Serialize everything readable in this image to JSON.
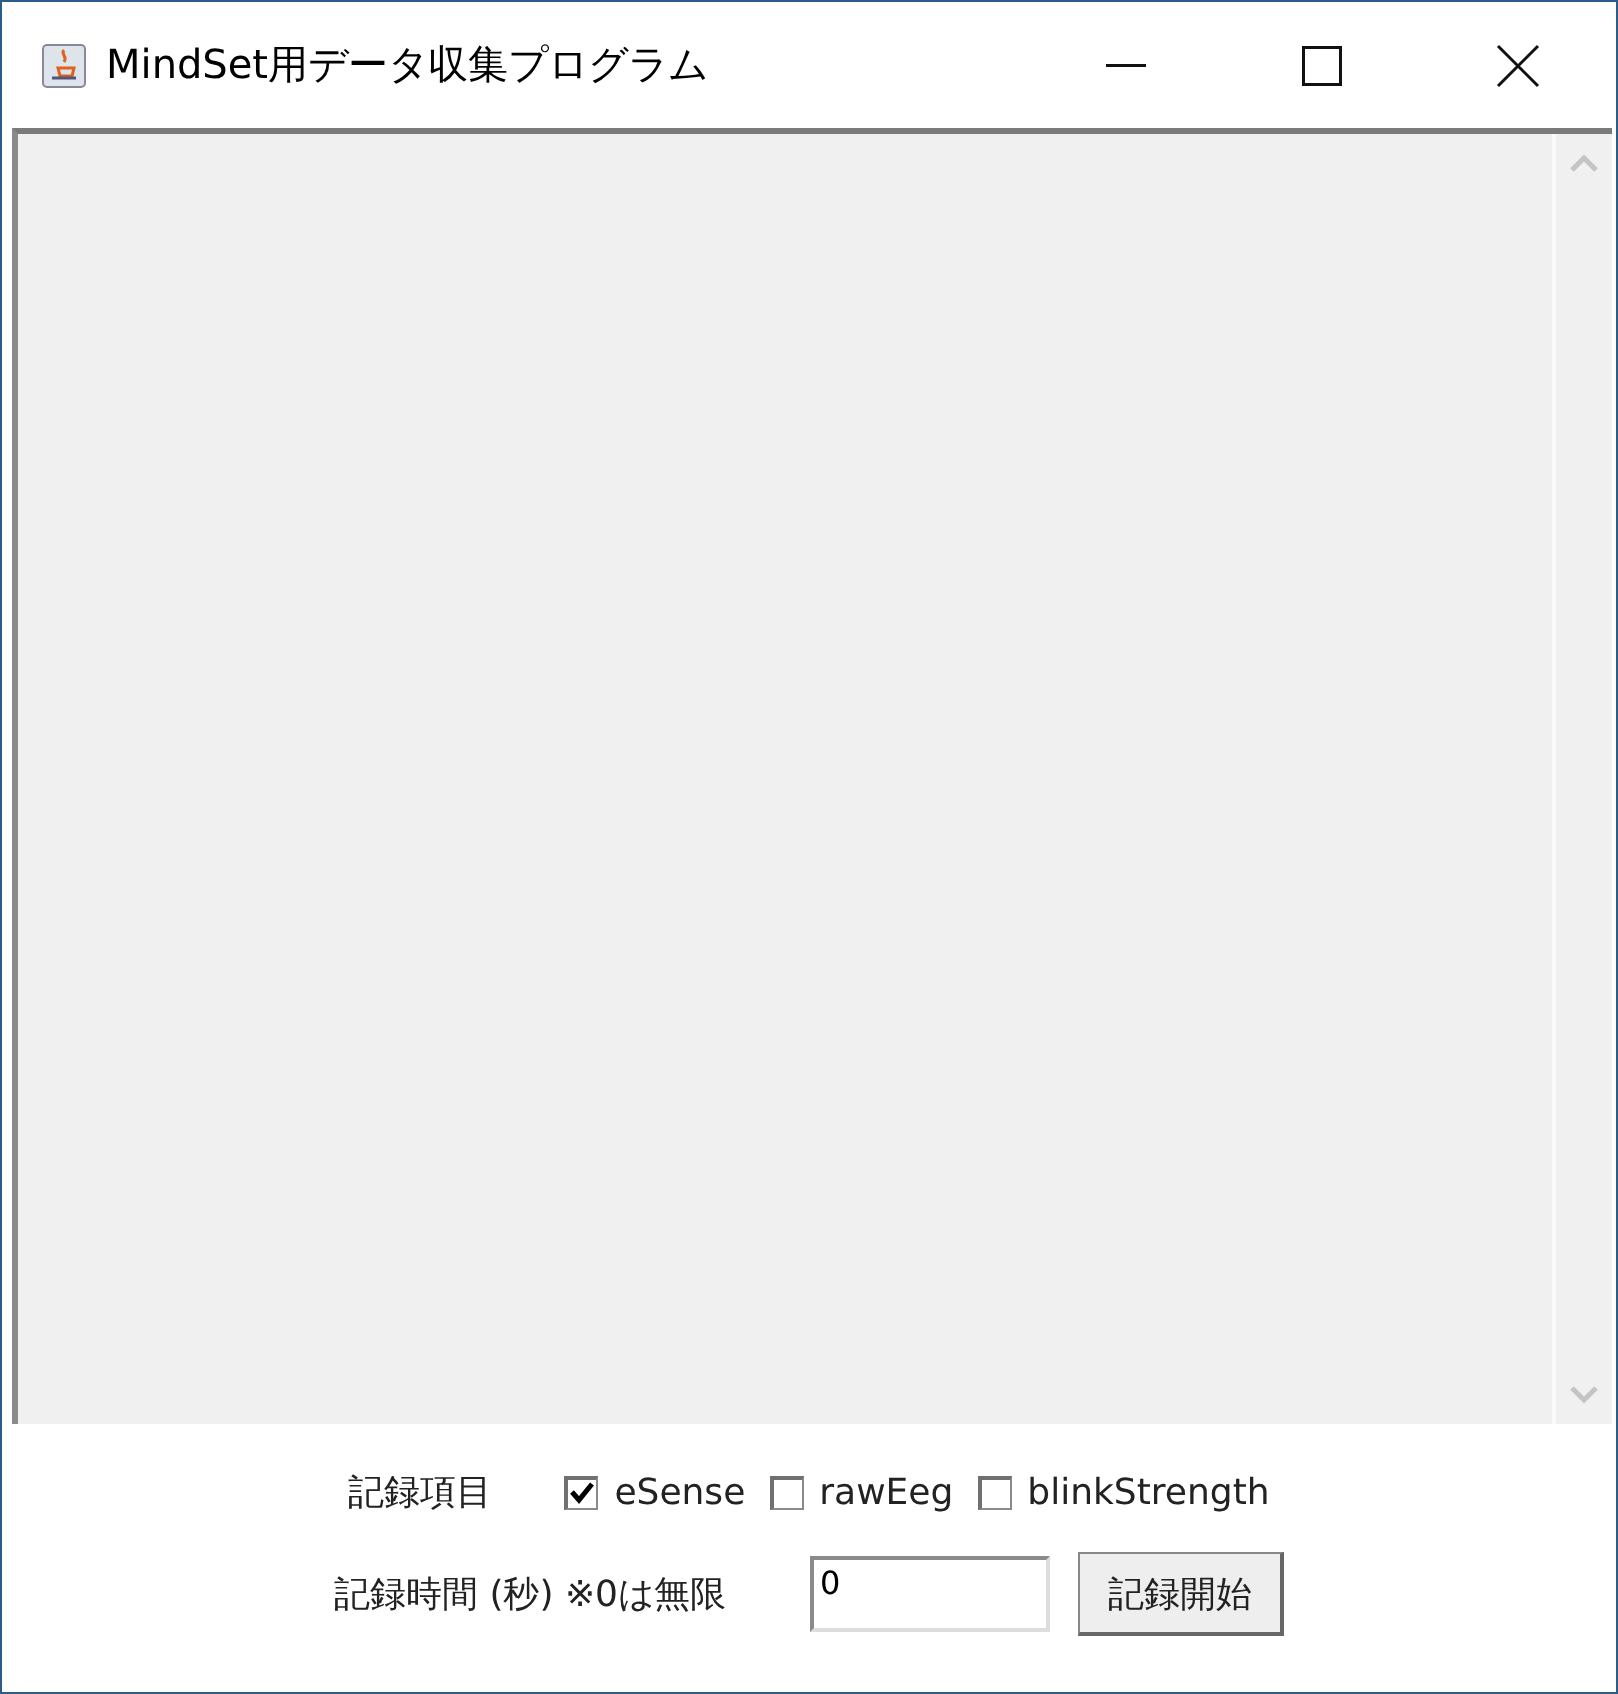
{
  "window": {
    "title": "MindSet用データ収集プログラム"
  },
  "record_items": {
    "label": "記録項目",
    "options": [
      {
        "label": "eSense",
        "checked": true
      },
      {
        "label": "rawEeg",
        "checked": false
      },
      {
        "label": "blinkStrength",
        "checked": false
      }
    ]
  },
  "record_time": {
    "label": "記録時間 (秒) ※0は無限",
    "value": "0",
    "button": "記録開始"
  }
}
